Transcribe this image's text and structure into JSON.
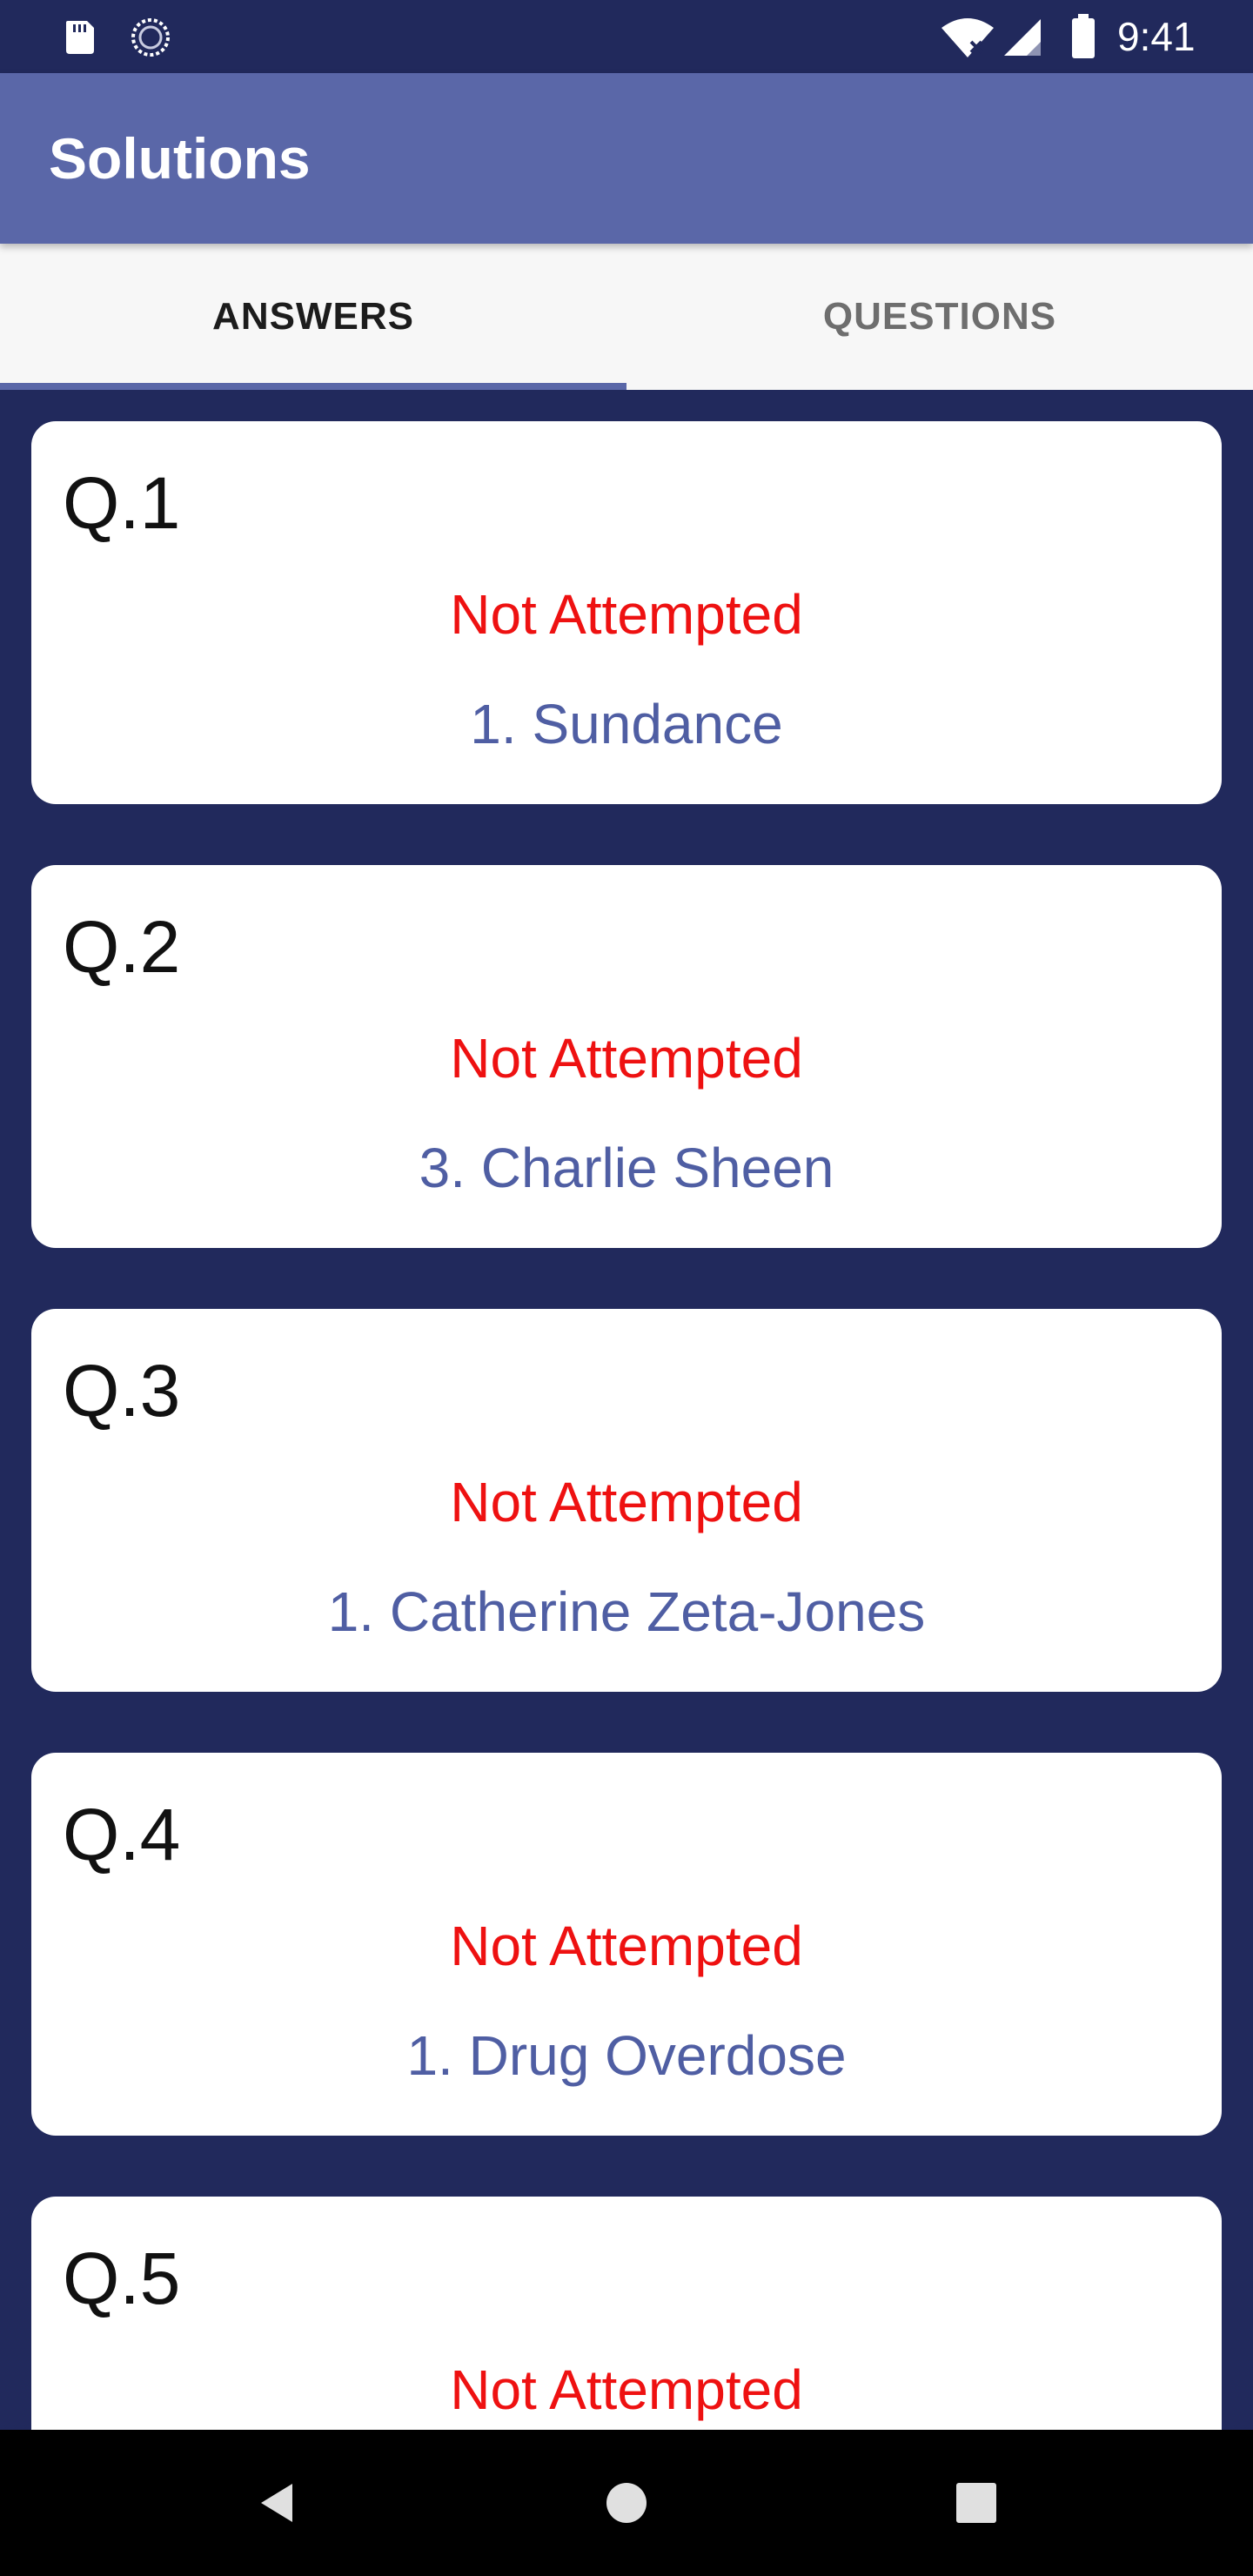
{
  "status_bar": {
    "time": "9:41",
    "icons": [
      "sd-card-icon",
      "sync-icon",
      "wifi-icon",
      "signal-icon",
      "battery-icon"
    ]
  },
  "app_bar": {
    "title": "Solutions",
    "color": "#5a67a8"
  },
  "tabs": [
    {
      "label": "ANSWERS",
      "selected": true
    },
    {
      "label": "QUESTIONS",
      "selected": false
    }
  ],
  "cards": [
    {
      "number": "Q.1",
      "status": "Not Attempted",
      "answer": "1. Sundance"
    },
    {
      "number": "Q.2",
      "status": "Not Attempted",
      "answer": "3. Charlie Sheen"
    },
    {
      "number": "Q.3",
      "status": "Not Attempted",
      "answer": "1. Catherine Zeta-Jones"
    },
    {
      "number": "Q.4",
      "status": "Not Attempted",
      "answer": "1. Drug Overdose"
    },
    {
      "number": "Q.5",
      "status": "Not Attempted",
      "answer": ""
    }
  ],
  "colors": {
    "background": "#21295c",
    "status_not_attempted": "#ee1111",
    "answer": "#4f5ea3"
  },
  "nav_bar": {
    "buttons": [
      "back-icon",
      "home-icon",
      "recents-icon"
    ]
  }
}
